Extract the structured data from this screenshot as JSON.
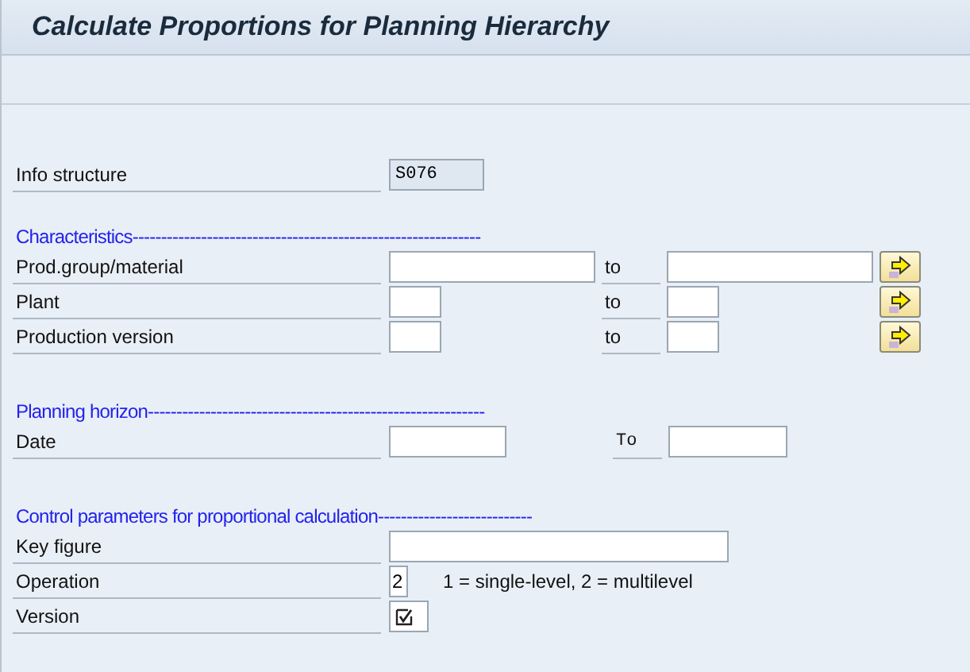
{
  "title": "Calculate Proportions for Planning Hierarchy",
  "info_structure": {
    "label": "Info structure",
    "value": "S076"
  },
  "characteristics": {
    "heading": "Characteristics-------------------------------------------------------------",
    "rows": [
      {
        "label": "Prod.group/material",
        "to_label": "to",
        "kind": "long"
      },
      {
        "label": "Plant",
        "to_label": "to",
        "kind": "short"
      },
      {
        "label": "Production version",
        "to_label": "to",
        "kind": "short"
      }
    ]
  },
  "planning_horizon": {
    "heading": "Planning horizon-----------------------------------------------------------",
    "label": "Date",
    "to_label": "To"
  },
  "control": {
    "heading": "Control parameters for proportional calculation---------------------------",
    "key_figure": {
      "label": "Key figure"
    },
    "operation": {
      "label": "Operation",
      "value": "2",
      "hint": "1 = single-level, 2 = multilevel"
    },
    "version": {
      "label": "Version",
      "checked": true
    }
  }
}
